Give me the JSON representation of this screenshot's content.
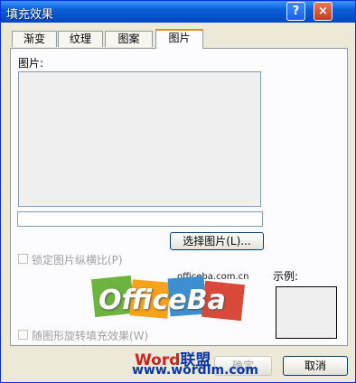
{
  "window": {
    "title": "填充效果",
    "help_button": "?",
    "close_button": "×"
  },
  "tabs": [
    {
      "label": "渐变",
      "active": false
    },
    {
      "label": "纹理",
      "active": false
    },
    {
      "label": "图案",
      "active": false
    },
    {
      "label": "图片",
      "active": true
    }
  ],
  "picture_tab": {
    "picture_label": "图片:",
    "file_path": "",
    "select_button": "选择图片(L)...",
    "lock_ratio_label": "锁定图片纵横比(P)",
    "rotate_with_shape_label": "随图形旋转填充效果(W)",
    "sample_label": "示例:"
  },
  "footer": {
    "ok_button": "确定",
    "cancel_button": "取消"
  },
  "watermark": {
    "site": "officeba.com.cn",
    "logo_text": "OfficeBa",
    "word_text": "Word联盟",
    "url": "www.wordlm.com"
  },
  "colors": {
    "titlebar": "#0a5fd8",
    "tab_highlight": "#e68b2c",
    "dialog_bg": "#ece9d8"
  }
}
